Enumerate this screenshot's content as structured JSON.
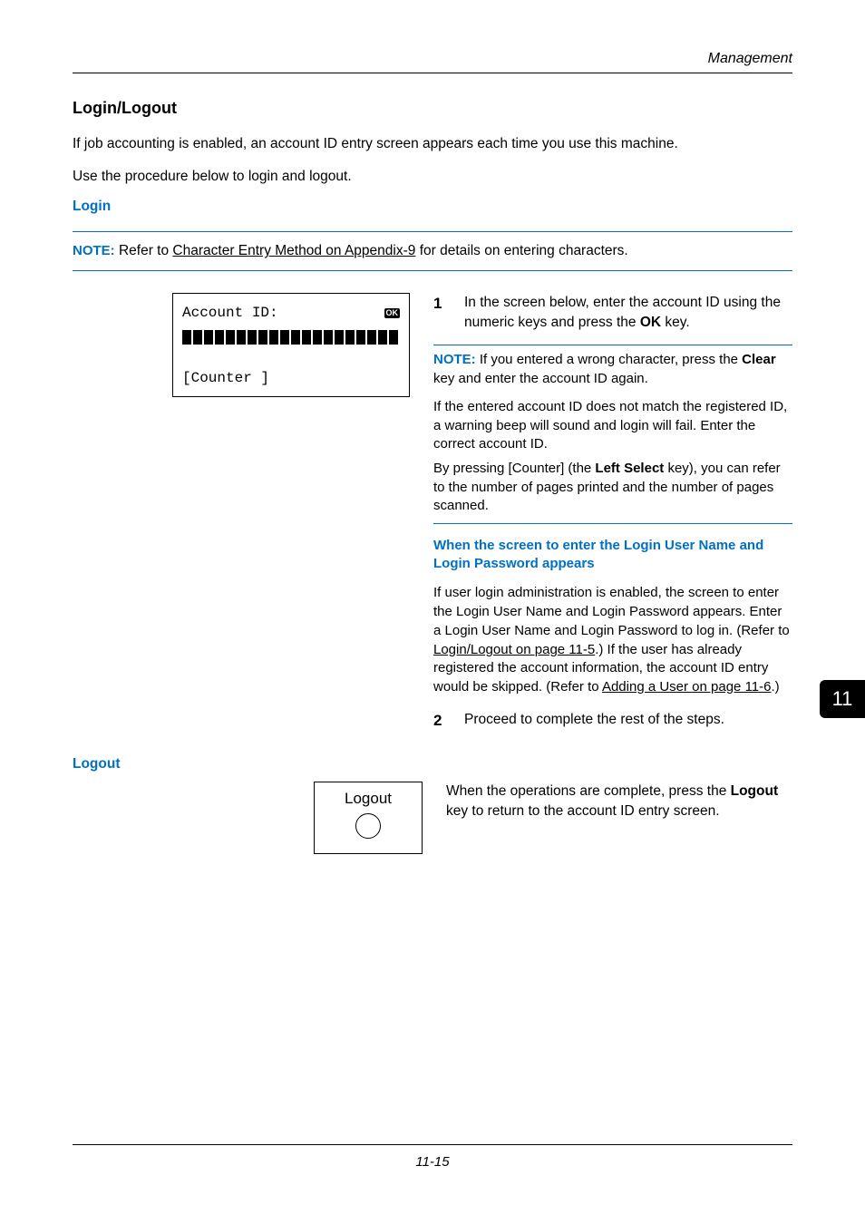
{
  "header": {
    "running": "Management"
  },
  "section": {
    "title": "Login/Logout",
    "intro1": "If job accounting is enabled, an account ID entry screen appears each time you use this machine.",
    "intro2": "Use the procedure below to login and logout."
  },
  "login": {
    "heading": "Login",
    "note_prefix": "NOTE:",
    "note_body": " Refer to ",
    "note_link": "Character Entry Method on Appendix-9",
    "note_tail": " for details on entering characters."
  },
  "screen": {
    "title": "Account ID:",
    "ok": "OK",
    "soft": "[Counter ]"
  },
  "step1": {
    "num": "1",
    "text_a": "In the screen below, enter the account ID using the numeric keys and press the ",
    "bold": "OK",
    "text_b": " key."
  },
  "mid_note": {
    "prefix": "NOTE:",
    "l1a": " If you entered a wrong character, press the ",
    "l1b": "Clear",
    "l1c": " key and enter the account ID again.",
    "p2": "If the entered account ID does not match the registered ID, a warning beep will sound and login will fail. Enter the correct account ID.",
    "p3a": "By pressing [Counter] (the ",
    "p3b": "Left Select",
    "p3c": " key), you can refer to the number of pages printed and the number of pages scanned."
  },
  "sub": {
    "heading": "When the screen to enter the Login User Name and Login Password appears",
    "para_a": "If user login administration is enabled, the screen to enter the Login User Name and Login Password appears. Enter a Login User Name and Login Password to log in. (Refer to ",
    "link1": "Login/Logout on page 11-5",
    "para_b": ".) If the user has already registered the account information, the account ID entry would be skipped. (Refer to ",
    "link2": "Adding a User on page 11-6",
    "para_c": ".)"
  },
  "step2": {
    "num": "2",
    "text": "Proceed to complete the rest of the steps."
  },
  "logout": {
    "heading": "Logout",
    "box_label": "Logout",
    "text_a": "When the operations are complete, press the ",
    "bold": "Logout",
    "text_b": " key to return to the account ID entry screen."
  },
  "tab": "11",
  "footer": {
    "page": "11-15"
  }
}
